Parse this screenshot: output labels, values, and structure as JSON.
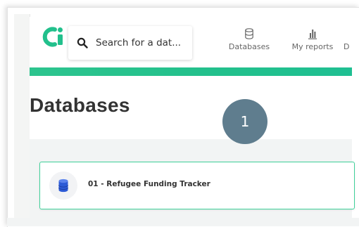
{
  "header": {
    "search": {
      "placeholder": "Search for a dat..."
    },
    "nav": [
      {
        "label": "Databases",
        "icon": "database-icon"
      },
      {
        "label": "My reports",
        "icon": "bar-chart-icon"
      },
      {
        "label": "D",
        "icon": ""
      }
    ]
  },
  "page": {
    "title": "Databases"
  },
  "databases": [
    {
      "name": "01 - Refugee Funding Tracker",
      "icon": "database-icon"
    }
  ],
  "annotation": {
    "step": "1"
  },
  "colors": {
    "brand_green": "#22c08c",
    "card_border": "#3fd19a",
    "badge": "#5f7d8e",
    "db_icon": "#2d5bd6"
  }
}
